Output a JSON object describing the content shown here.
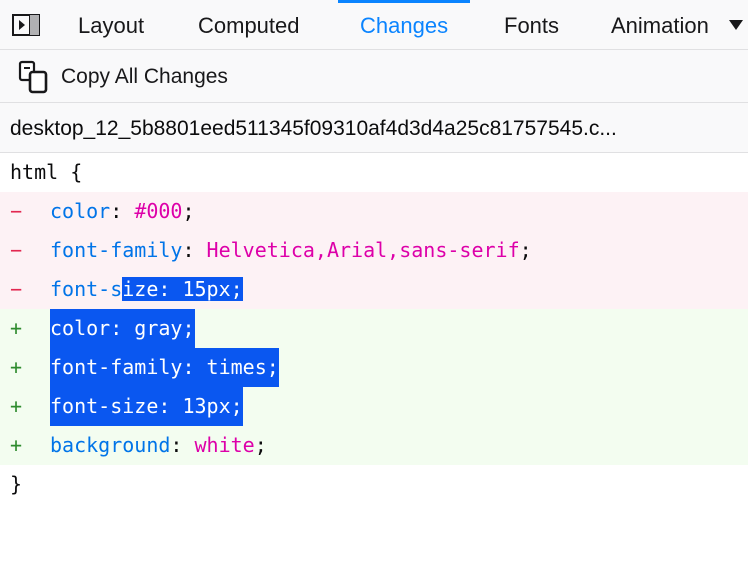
{
  "tabs": [
    {
      "label": "Layout",
      "selected": false
    },
    {
      "label": "Computed",
      "selected": false
    },
    {
      "label": "Changes",
      "selected": true
    },
    {
      "label": "Fonts",
      "selected": false
    },
    {
      "label": "Animation",
      "selected": false
    }
  ],
  "toolbar": {
    "copy_all_label": "Copy All Changes"
  },
  "source": {
    "name": "desktop_12_5b8801eed511345f09310af4d3d4a25c81757545.c..."
  },
  "code": {
    "selector": "html {",
    "closing": "}",
    "removed": [
      {
        "marker": "−",
        "prop": "color",
        "colon": ":",
        "value": "#000",
        "end": ";"
      },
      {
        "marker": "−",
        "prop": "font-family",
        "colon": ":",
        "value": "Helvetica,Arial,sans-serif",
        "end": ";"
      },
      {
        "marker": "−",
        "prop_a": "font-s",
        "prop_b": "ize",
        "colon": ":",
        "space": " ",
        "value": "15px",
        "end": ";"
      }
    ],
    "added": [
      {
        "marker": "+",
        "text": "color: gray;"
      },
      {
        "marker": "+",
        "text": "font-family: times;"
      },
      {
        "marker": "+",
        "text": "font-size: 13px;"
      },
      {
        "marker": "+",
        "prop": "background",
        "colon": ":",
        "value": "white",
        "end": ";"
      }
    ]
  },
  "colors": {
    "accent": "#0a84ff",
    "selection": "#0a57f0",
    "removed_bg": "#fdf2f5",
    "added_bg": "#f3fdf0",
    "property": "#0074e8",
    "value": "#dd00a9"
  }
}
